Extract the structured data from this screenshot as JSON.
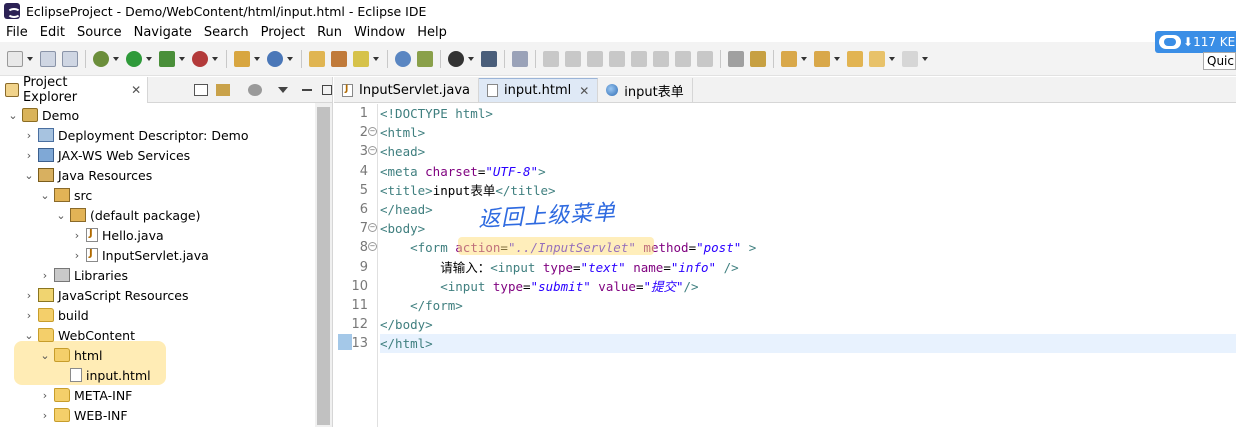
{
  "window": {
    "title": "EclipseProject - Demo/WebContent/html/input.html - Eclipse IDE"
  },
  "menu": [
    "File",
    "Edit",
    "Source",
    "Navigate",
    "Search",
    "Project",
    "Run",
    "Window",
    "Help"
  ],
  "cloud_widget": {
    "label": "117 KE",
    "quick_access": "Quick"
  },
  "explorer": {
    "tab_label": "Project Explorer",
    "tree": [
      {
        "label": "Demo",
        "icon": "project-icon",
        "twisty": "expanded",
        "indent": 0
      },
      {
        "label": "Deployment Descriptor: Demo",
        "icon": "descriptor-icon",
        "twisty": "collapsed",
        "indent": 1
      },
      {
        "label": "JAX-WS Web Services",
        "icon": "web-services-icon",
        "twisty": "collapsed",
        "indent": 1
      },
      {
        "label": "Java Resources",
        "icon": "java-resources-icon",
        "twisty": "expanded",
        "indent": 1
      },
      {
        "label": "src",
        "icon": "source-folder-icon",
        "twisty": "expanded",
        "indent": 2
      },
      {
        "label": "(default package)",
        "icon": "package-icon",
        "twisty": "expanded",
        "indent": 3
      },
      {
        "label": "Hello.java",
        "icon": "java-file-icon",
        "twisty": "collapsed",
        "indent": 4
      },
      {
        "label": "InputServlet.java",
        "icon": "java-file-icon",
        "twisty": "collapsed",
        "indent": 4
      },
      {
        "label": "Libraries",
        "icon": "library-icon",
        "twisty": "collapsed",
        "indent": 2
      },
      {
        "label": "JavaScript Resources",
        "icon": "javascript-resources-icon",
        "twisty": "collapsed",
        "indent": 1
      },
      {
        "label": "build",
        "icon": "folder-icon",
        "twisty": "collapsed",
        "indent": 1
      },
      {
        "label": "WebContent",
        "icon": "folder-icon",
        "twisty": "expanded",
        "indent": 1
      },
      {
        "label": "html",
        "icon": "folder-icon",
        "twisty": "expanded",
        "indent": 2
      },
      {
        "label": "input.html",
        "icon": "html-file-icon",
        "twisty": "none",
        "indent": 3
      },
      {
        "label": "META-INF",
        "icon": "folder-icon",
        "twisty": "collapsed",
        "indent": 2
      },
      {
        "label": "WEB-INF",
        "icon": "folder-icon",
        "twisty": "collapsed",
        "indent": 2
      }
    ]
  },
  "editor": {
    "tabs": [
      {
        "label": "InputServlet.java",
        "icon": "java-file-icon",
        "active": false
      },
      {
        "label": "input.html",
        "icon": "html-file-icon",
        "active": true
      },
      {
        "label": "input表单",
        "icon": "globe-icon",
        "active": false
      }
    ],
    "lines": [
      {
        "n": "1",
        "fold": "",
        "code": [
          [
            "doct",
            "<!DOCTYPE html>"
          ]
        ]
      },
      {
        "n": "2",
        "fold": "-",
        "code": [
          [
            "tag",
            "<html>"
          ]
        ]
      },
      {
        "n": "3",
        "fold": "-",
        "code": [
          [
            "tag",
            "<head>"
          ]
        ]
      },
      {
        "n": "4",
        "fold": "",
        "code": [
          [
            "tag",
            "<meta "
          ],
          [
            "att",
            "charset"
          ],
          [
            "txt",
            "="
          ],
          [
            "val",
            "\"UTF-8\""
          ],
          [
            "tag",
            ">"
          ]
        ]
      },
      {
        "n": "5",
        "fold": "",
        "code": [
          [
            "tag",
            "<title>"
          ],
          [
            "txt",
            "input表单"
          ],
          [
            "tag",
            "</title>"
          ]
        ]
      },
      {
        "n": "6",
        "fold": "",
        "code": [
          [
            "tag",
            "</head>"
          ]
        ]
      },
      {
        "n": "7",
        "fold": "-",
        "code": [
          [
            "tag",
            "<body>"
          ]
        ]
      },
      {
        "n": "8",
        "fold": "-",
        "code": [
          [
            "txt",
            "    "
          ],
          [
            "tag",
            "<form "
          ],
          [
            "att",
            "action"
          ],
          [
            "txt",
            "="
          ],
          [
            "val",
            "\"../InputServlet\""
          ],
          [
            "txt",
            " "
          ],
          [
            "att",
            "method"
          ],
          [
            "txt",
            "="
          ],
          [
            "val",
            "\"post\""
          ],
          [
            "txt",
            " "
          ],
          [
            "tag",
            ">"
          ]
        ]
      },
      {
        "n": "9",
        "fold": "",
        "code": [
          [
            "txt",
            "        请输入："
          ],
          [
            "tag",
            "<input "
          ],
          [
            "att",
            "type"
          ],
          [
            "txt",
            "="
          ],
          [
            "val",
            "\"text\""
          ],
          [
            "txt",
            " "
          ],
          [
            "att",
            "name"
          ],
          [
            "txt",
            "="
          ],
          [
            "val",
            "\"info\""
          ],
          [
            "txt",
            " "
          ],
          [
            "tag",
            "/>"
          ]
        ]
      },
      {
        "n": "10",
        "fold": "",
        "code": [
          [
            "txt",
            "        "
          ],
          [
            "tag",
            "<input "
          ],
          [
            "att",
            "type"
          ],
          [
            "txt",
            "="
          ],
          [
            "val",
            "\"submit\""
          ],
          [
            "txt",
            " "
          ],
          [
            "att",
            "value"
          ],
          [
            "txt",
            "="
          ],
          [
            "val",
            "\"提交\""
          ],
          [
            "tag",
            "/>"
          ]
        ]
      },
      {
        "n": "11",
        "fold": "",
        "code": [
          [
            "txt",
            "    "
          ],
          [
            "tag",
            "</form>"
          ]
        ]
      },
      {
        "n": "12",
        "fold": "",
        "code": [
          [
            "tag",
            "</body>"
          ]
        ]
      },
      {
        "n": "13",
        "fold": "",
        "code": [
          [
            "tag",
            "</html>"
          ]
        ],
        "current": true
      }
    ]
  },
  "annotation": "返回上级菜单",
  "colors": {
    "tag": "#3f7f7f",
    "attribute": "#7f007f",
    "value": "#2a00ff",
    "highlight": "#ffdd78",
    "annotation": "#2e6ae0"
  }
}
